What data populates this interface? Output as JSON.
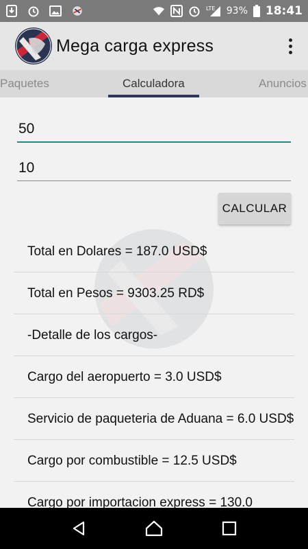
{
  "status_bar": {
    "battery": "93%",
    "time": "18:41",
    "network": "LTE",
    "left_icons": [
      "download-icon",
      "alarm-icon",
      "image-icon",
      "app-icon"
    ],
    "right_icons": [
      "wifi-icon",
      "nfc-icon",
      "alarm-icon",
      "signal-icon",
      "battery-icon"
    ]
  },
  "app_bar": {
    "title": "Mega carga express"
  },
  "tabs": [
    {
      "label": "Paquetes",
      "active": false
    },
    {
      "label": "Calculadora",
      "active": true
    },
    {
      "label": "Anuncios",
      "active": false
    }
  ],
  "form": {
    "field1_value": "50",
    "field2_value": "10",
    "calculate_label": "CALCULAR"
  },
  "results": [
    "Total en Dolares = 187.0 USD$",
    "Total en Pesos = 9303.25 RD$",
    "-Detalle de los cargos-",
    "Cargo del aeropuerto = 3.0 USD$",
    "Servicio de paqueteria de Aduana = 6.0 USD$",
    "Cargo por combustible = 12.5 USD$",
    "Cargo por importacion express = 130.0"
  ],
  "colors": {
    "accent": "#1f8a85",
    "tab_indicator": "#2d3958",
    "status_bar": "#7a7a7a",
    "app_bar": "#e6e6e6"
  }
}
